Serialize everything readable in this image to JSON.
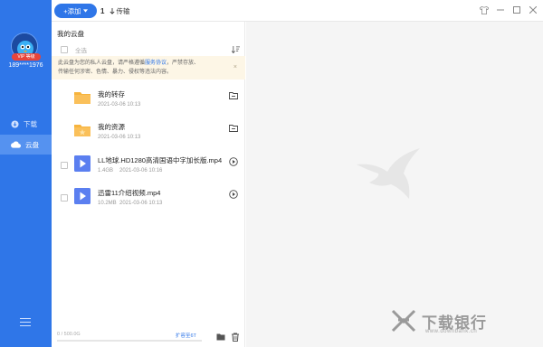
{
  "colors": {
    "brand": "#2f76e8",
    "vip": "#e8443a",
    "folder": "#f7b43d",
    "video": "#5b7ff0",
    "notice_bg": "#fdf6e6"
  },
  "sidebar": {
    "vip_badge": "VIP 等级",
    "user_id": "189****1976",
    "items": [
      {
        "label": "下载",
        "icon": "download-icon",
        "active": false
      },
      {
        "label": "云盘",
        "icon": "cloud-icon",
        "active": true
      }
    ]
  },
  "topbar": {
    "add_label": "+添加",
    "transfer_count": "1",
    "transfer_label": "传输"
  },
  "panel": {
    "title": "我的云盘",
    "select_all": "全选",
    "notice_line1_pre": "此云盘为您的私人云盘，请严格遵循",
    "notice_link": "服务协议",
    "notice_line1_post": "，严禁存放、",
    "notice_line2": "传输任何涉密、色情、暴力、侵权等违法内容。",
    "notice_close": "×",
    "files": [
      {
        "name": "我的转存",
        "size": "",
        "date": "2021-03-06 10:13",
        "type": "folder"
      },
      {
        "name": "我的资源",
        "size": "",
        "date": "2021-03-06 10:13",
        "type": "folder"
      },
      {
        "name": "LL地球.HD1280高清国语中字加长版.mp4",
        "size": "1.4GB",
        "date": "2021-03-06 10:16",
        "type": "video"
      },
      {
        "name": "迅雷11介绍视频.mp4",
        "size": "10.2MB",
        "date": "2021-03-06 10:13",
        "type": "video"
      }
    ],
    "storage": "0 / 500.0G",
    "storage_used_fraction": 0,
    "expand": "扩容至6T"
  },
  "watermark": {
    "text": "下载银行",
    "url": "www.downbank.cn"
  }
}
